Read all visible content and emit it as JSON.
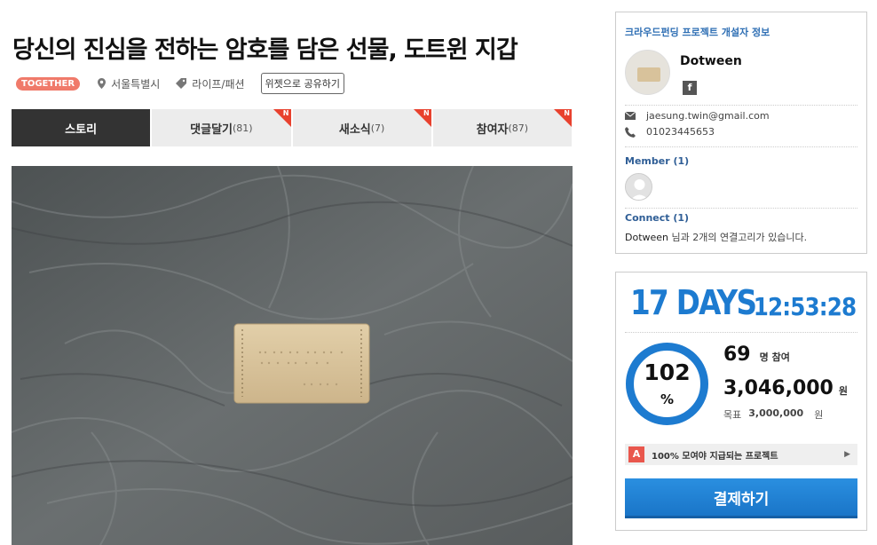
{
  "project": {
    "title": "당신의 진심을 전하는 암호를 담은 선물, 도트윈 지갑",
    "badge": "TOGETHER",
    "location": "서울특별시",
    "category": "라이프/패션",
    "share_label": "위젯으로 공유하기"
  },
  "tabs": [
    {
      "label": "스토리",
      "count": "",
      "active": true,
      "new": false
    },
    {
      "label": "댓글달기",
      "count": "(81)",
      "active": false,
      "new": true
    },
    {
      "label": "새소식",
      "count": "(7)",
      "active": false,
      "new": true
    },
    {
      "label": "참여자",
      "count": "(87)",
      "active": false,
      "new": true
    }
  ],
  "new_badge": "N",
  "developer": {
    "heading": "크라우드펀딩 프로젝트 개설자 정보",
    "name": "Dotween",
    "facebook": "f",
    "email": "jaesung.twin@gmail.com",
    "phone": "01023445653",
    "member_label": "Member (1)",
    "connect_label": "Connect (1)",
    "connect_name": "Dotween",
    "connect_text": " 님과 2개의 연결고리가 있습니다."
  },
  "funding": {
    "days": "17 DAYS",
    "time": "12:53:28",
    "percent": "102",
    "percent_sign": "%",
    "percent_value": 102,
    "participants": "69",
    "participants_unit": "명 참여",
    "raised": "3,046,000",
    "raised_unit": "원",
    "goal_label": "목표",
    "goal": "3,000,000",
    "goal_unit": "원",
    "notice_badge": "A",
    "notice": "100% 모여야 지급되는 프로젝트",
    "pay_label": "결제하기"
  },
  "colors": {
    "accent": "#1d7bd0",
    "badge": "#f07a6a",
    "new": "#e8412e",
    "tab_active": "#333333"
  }
}
